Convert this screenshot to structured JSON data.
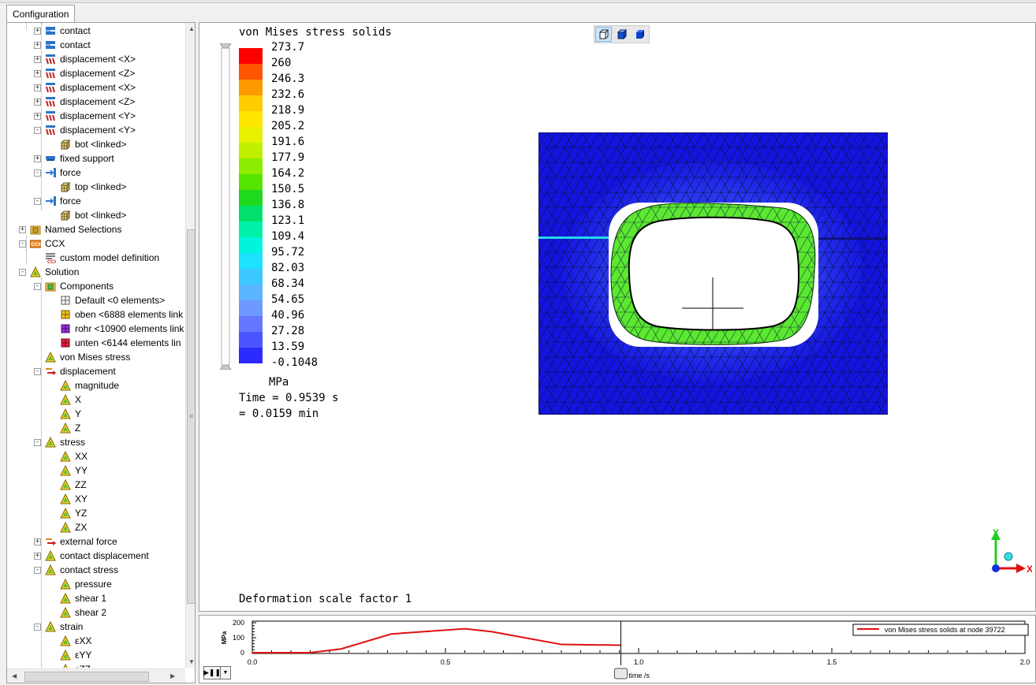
{
  "tab": {
    "label": "Configuration"
  },
  "tree": [
    {
      "level": 2,
      "toggle": "+",
      "icon": "contact-icon",
      "label": "contact"
    },
    {
      "level": 2,
      "toggle": "+",
      "icon": "contact-icon",
      "label": "contact"
    },
    {
      "level": 2,
      "toggle": "+",
      "icon": "displacement-icon",
      "label": "displacement <X>"
    },
    {
      "level": 2,
      "toggle": "+",
      "icon": "displacement-icon",
      "label": "displacement <Z>"
    },
    {
      "level": 2,
      "toggle": "+",
      "icon": "displacement-icon",
      "label": "displacement <X>"
    },
    {
      "level": 2,
      "toggle": "+",
      "icon": "displacement-icon",
      "label": "displacement <Z>"
    },
    {
      "level": 2,
      "toggle": "+",
      "icon": "displacement-icon",
      "label": "displacement <Y>"
    },
    {
      "level": 2,
      "toggle": "-",
      "icon": "displacement-icon",
      "label": "displacement <Y>"
    },
    {
      "level": 3,
      "toggle": "",
      "icon": "mesh-cube-icon",
      "label": "bot <linked>"
    },
    {
      "level": 2,
      "toggle": "+",
      "icon": "fixed-support-icon",
      "label": "fixed support"
    },
    {
      "level": 2,
      "toggle": "-",
      "icon": "force-icon",
      "label": "force"
    },
    {
      "level": 3,
      "toggle": "",
      "icon": "mesh-cube-icon",
      "label": "top <linked>"
    },
    {
      "level": 2,
      "toggle": "-",
      "icon": "force-icon",
      "label": "force"
    },
    {
      "level": 3,
      "toggle": "",
      "icon": "mesh-cube-icon",
      "label": "bot <linked>"
    },
    {
      "level": 1,
      "toggle": "+",
      "icon": "named-selections-icon",
      "label": "Named Selections"
    },
    {
      "level": 1,
      "toggle": "-",
      "icon": "ccx-icon",
      "label": "CCX"
    },
    {
      "level": 2,
      "toggle": "",
      "icon": "ccx-definition-icon",
      "label": "custom model definition"
    },
    {
      "level": 1,
      "toggle": "-",
      "icon": "solution-icon",
      "label": "Solution"
    },
    {
      "level": 2,
      "toggle": "-",
      "icon": "components-icon",
      "label": "Components"
    },
    {
      "level": 3,
      "toggle": "",
      "icon": "component-default-icon",
      "label": "Default <0 elements>"
    },
    {
      "level": 3,
      "toggle": "",
      "icon": "component-yellow-icon",
      "label": "oben <6888 elements link"
    },
    {
      "level": 3,
      "toggle": "",
      "icon": "component-purple-icon",
      "label": "rohr <10900 elements link"
    },
    {
      "level": 3,
      "toggle": "",
      "icon": "component-red-icon",
      "label": "unten <6144 elements lin"
    },
    {
      "level": 2,
      "toggle": "",
      "icon": "result-icon",
      "label": "von Mises stress"
    },
    {
      "level": 2,
      "toggle": "-",
      "icon": "displacement-result-icon",
      "label": "displacement"
    },
    {
      "level": 3,
      "toggle": "",
      "icon": "result-icon",
      "label": "magnitude"
    },
    {
      "level": 3,
      "toggle": "",
      "icon": "result-icon",
      "label": "X"
    },
    {
      "level": 3,
      "toggle": "",
      "icon": "result-icon",
      "label": "Y"
    },
    {
      "level": 3,
      "toggle": "",
      "icon": "result-icon",
      "label": "Z"
    },
    {
      "level": 2,
      "toggle": "-",
      "icon": "result-icon",
      "label": "stress"
    },
    {
      "level": 3,
      "toggle": "",
      "icon": "result-icon",
      "label": "XX"
    },
    {
      "level": 3,
      "toggle": "",
      "icon": "result-icon",
      "label": "YY"
    },
    {
      "level": 3,
      "toggle": "",
      "icon": "result-icon",
      "label": "ZZ"
    },
    {
      "level": 3,
      "toggle": "",
      "icon": "result-icon",
      "label": "XY"
    },
    {
      "level": 3,
      "toggle": "",
      "icon": "result-icon",
      "label": "YZ"
    },
    {
      "level": 3,
      "toggle": "",
      "icon": "result-icon",
      "label": "ZX"
    },
    {
      "level": 2,
      "toggle": "+",
      "icon": "external-force-icon",
      "label": "external force"
    },
    {
      "level": 2,
      "toggle": "+",
      "icon": "result-icon",
      "label": "contact displacement"
    },
    {
      "level": 2,
      "toggle": "-",
      "icon": "result-icon",
      "label": "contact stress"
    },
    {
      "level": 3,
      "toggle": "",
      "icon": "result-icon",
      "label": "pressure"
    },
    {
      "level": 3,
      "toggle": "",
      "icon": "result-icon",
      "label": "shear 1"
    },
    {
      "level": 3,
      "toggle": "",
      "icon": "result-icon",
      "label": "shear 2"
    },
    {
      "level": 2,
      "toggle": "-",
      "icon": "result-icon",
      "label": "strain"
    },
    {
      "level": 3,
      "toggle": "",
      "icon": "result-icon",
      "label": "εXX"
    },
    {
      "level": 3,
      "toggle": "",
      "icon": "result-icon",
      "label": "εYY"
    },
    {
      "level": 3,
      "toggle": "",
      "icon": "result-icon",
      "label": "εZZ"
    }
  ],
  "view": {
    "title": "von Mises stress solids",
    "unit": "MPa",
    "time_s": "Time = 0.9539 s",
    "time_min": "= 0.0159 min",
    "deformation": "Deformation scale factor 1",
    "legend": {
      "values": [
        "273.7",
        "260",
        "246.3",
        "232.6",
        "218.9",
        "205.2",
        "191.6",
        "177.9",
        "164.2",
        "150.5",
        "136.8",
        "123.1",
        "109.4",
        "95.72",
        "82.03",
        "68.34",
        "54.65",
        "40.96",
        "27.28",
        "13.59",
        "-0.1048"
      ],
      "colors": [
        "#ff0000",
        "#ff5500",
        "#ff9900",
        "#ffcc00",
        "#ffe600",
        "#e6f000",
        "#bff000",
        "#8ced00",
        "#55e400",
        "#1ed91e",
        "#00e06a",
        "#00f0a8",
        "#00f5dc",
        "#1ee0ff",
        "#3cc8ff",
        "#5ab4ff",
        "#6e9aff",
        "#6478ff",
        "#4a55ff",
        "#2b2bff"
      ]
    },
    "axes": {
      "x": "X",
      "y": "Y"
    }
  },
  "timeline": {
    "legend": "von Mises stress solids at node 39722",
    "ylabel": "MPa",
    "xlabel": "time /s",
    "x_ticks": [
      "0.0",
      "0.5",
      "1.0",
      "1.5",
      "2.0"
    ],
    "y_ticks": [
      "200",
      "100",
      "0"
    ],
    "marker_time": 0.9539,
    "color": "#e01010",
    "series": [
      [
        0,
        0
      ],
      [
        0.15,
        0
      ],
      [
        0.23,
        25
      ],
      [
        0.36,
        125
      ],
      [
        0.55,
        160
      ],
      [
        0.62,
        140
      ],
      [
        0.8,
        55
      ],
      [
        0.955,
        50
      ]
    ]
  }
}
